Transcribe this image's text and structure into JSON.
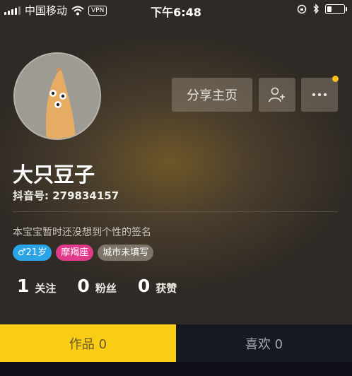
{
  "status_bar": {
    "carrier": "中国移动",
    "vpn": "VPN",
    "time": "下午6:48"
  },
  "profile": {
    "name": "大只豆子",
    "id_label": "抖音号: 279834157",
    "signature": "本宝宝暂时还没想到个性的签名",
    "tags": {
      "gender_age": "♂21岁",
      "zodiac": "摩羯座",
      "city": "城市未填写"
    }
  },
  "actions": {
    "share_label": "分享主页"
  },
  "stats": {
    "following": {
      "count": "1",
      "label": "关注"
    },
    "followers": {
      "count": "0",
      "label": "粉丝"
    },
    "likes": {
      "count": "0",
      "label": "获赞"
    }
  },
  "tabs": {
    "works": "作品 0",
    "liked": "喜欢 0"
  },
  "colors": {
    "accent": "#f9cc16",
    "gender_tag": "#2aa4e6",
    "zodiac_tag": "#e23a8a",
    "notification_dot": "#f7c21b"
  }
}
